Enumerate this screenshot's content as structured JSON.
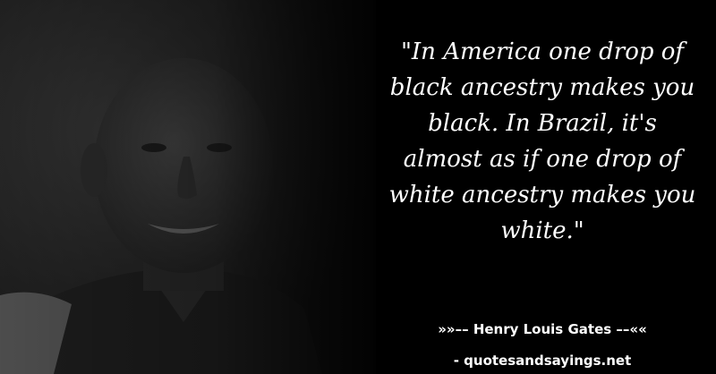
{
  "quote": {
    "lines": [
      "\"In America one drop of",
      "black ancestry makes you",
      "black. In Brazil, it's",
      "almost as if one drop of",
      "white ancestry makes you",
      "white.\""
    ]
  },
  "attribution": {
    "author_line": "»»–– Henry Louis Gates ––««",
    "source_line": "- quotesandsayings.net"
  },
  "colors": {
    "background": "#000000",
    "text": "#ffffff"
  }
}
